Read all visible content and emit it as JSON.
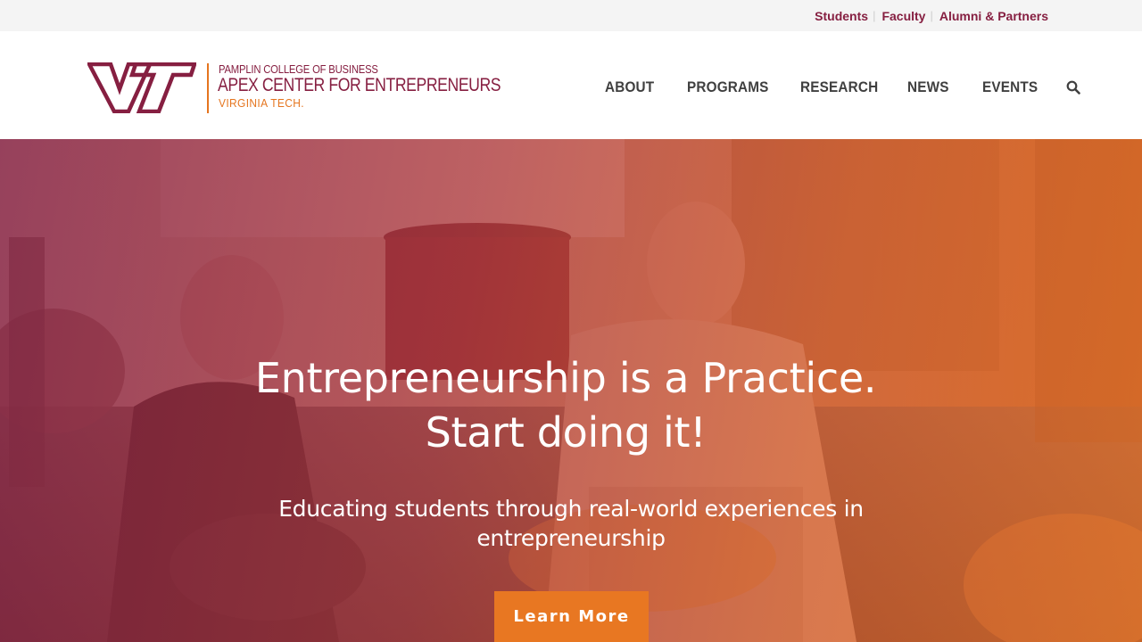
{
  "utility_nav": {
    "links": [
      {
        "label": "Students"
      },
      {
        "label": "Faculty"
      },
      {
        "label": "Alumni & Partners"
      }
    ],
    "separator": "|"
  },
  "logo": {
    "line1": "PAMPLIN COLLEGE OF BUSINESS",
    "line2": "APEX CENTER FOR ENTREPRENEURS",
    "line3": "VIRGINIA TECH.",
    "icon": "vt-logo-icon",
    "colors": {
      "maroon": "#861f41",
      "orange": "#e5751f"
    }
  },
  "main_nav": {
    "items": [
      {
        "label": "ABOUT"
      },
      {
        "label": "PROGRAMS"
      },
      {
        "label": "RESEARCH"
      },
      {
        "label": "NEWS"
      },
      {
        "label": "EVENTS"
      }
    ],
    "search_icon": "search-icon"
  },
  "hero": {
    "title_line1": "Entrepreneurship is a Practice.",
    "title_line2": "Start doing it!",
    "subtitle": "Educating students through real-world experiences in entrepreneurship",
    "button_label": "Learn More",
    "button_color": "#e87722",
    "overlay_colors": [
      "#861f41",
      "#e87722"
    ]
  }
}
